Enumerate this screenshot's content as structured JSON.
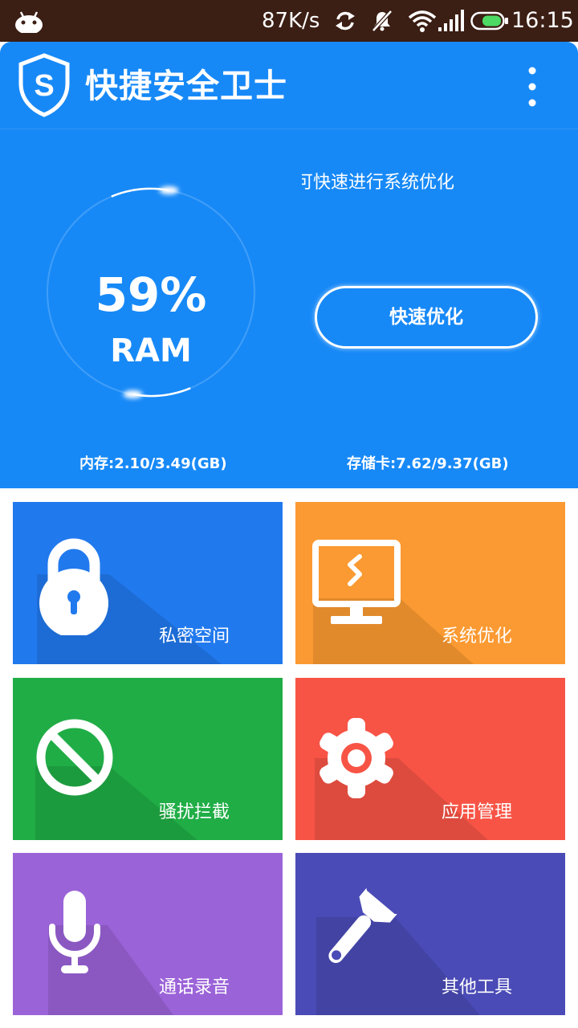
{
  "status_bar": {
    "speed": "87K/s",
    "time": "16:15",
    "icons": [
      "android-icon",
      "sync-icon",
      "mute-icon",
      "wifi-icon",
      "signal-icon",
      "battery-icon"
    ]
  },
  "app": {
    "title": "快捷安全卫士",
    "logo_letter": "S"
  },
  "dashboard": {
    "ram_percent": "59%",
    "ram_label": "RAM",
    "ram_usage_fraction": 0.59,
    "tip": "可快速进行系统优化",
    "optimize_label": "快速优化",
    "memory_text": "内存:2.10/3.49(GB)",
    "storage_text": "存储卡:7.62/9.37(GB)"
  },
  "tiles": [
    {
      "label": "私密空间",
      "color": "#2179ee",
      "icon": "lock-icon"
    },
    {
      "label": "系统优化",
      "color": "#fb9a32",
      "icon": "monitor-icon"
    },
    {
      "label": "骚扰拦截",
      "color": "#20ad46",
      "icon": "block-icon"
    },
    {
      "label": "应用管理",
      "color": "#f75446",
      "icon": "gear-icon"
    },
    {
      "label": "通话录音",
      "color": "#9b63d8",
      "icon": "microphone-icon"
    },
    {
      "label": "其他工具",
      "color": "#4a4bb6",
      "icon": "wrench-icon"
    }
  ],
  "colors": {
    "status_bar": "#3b1e14",
    "header_blue": "#1789f7"
  }
}
